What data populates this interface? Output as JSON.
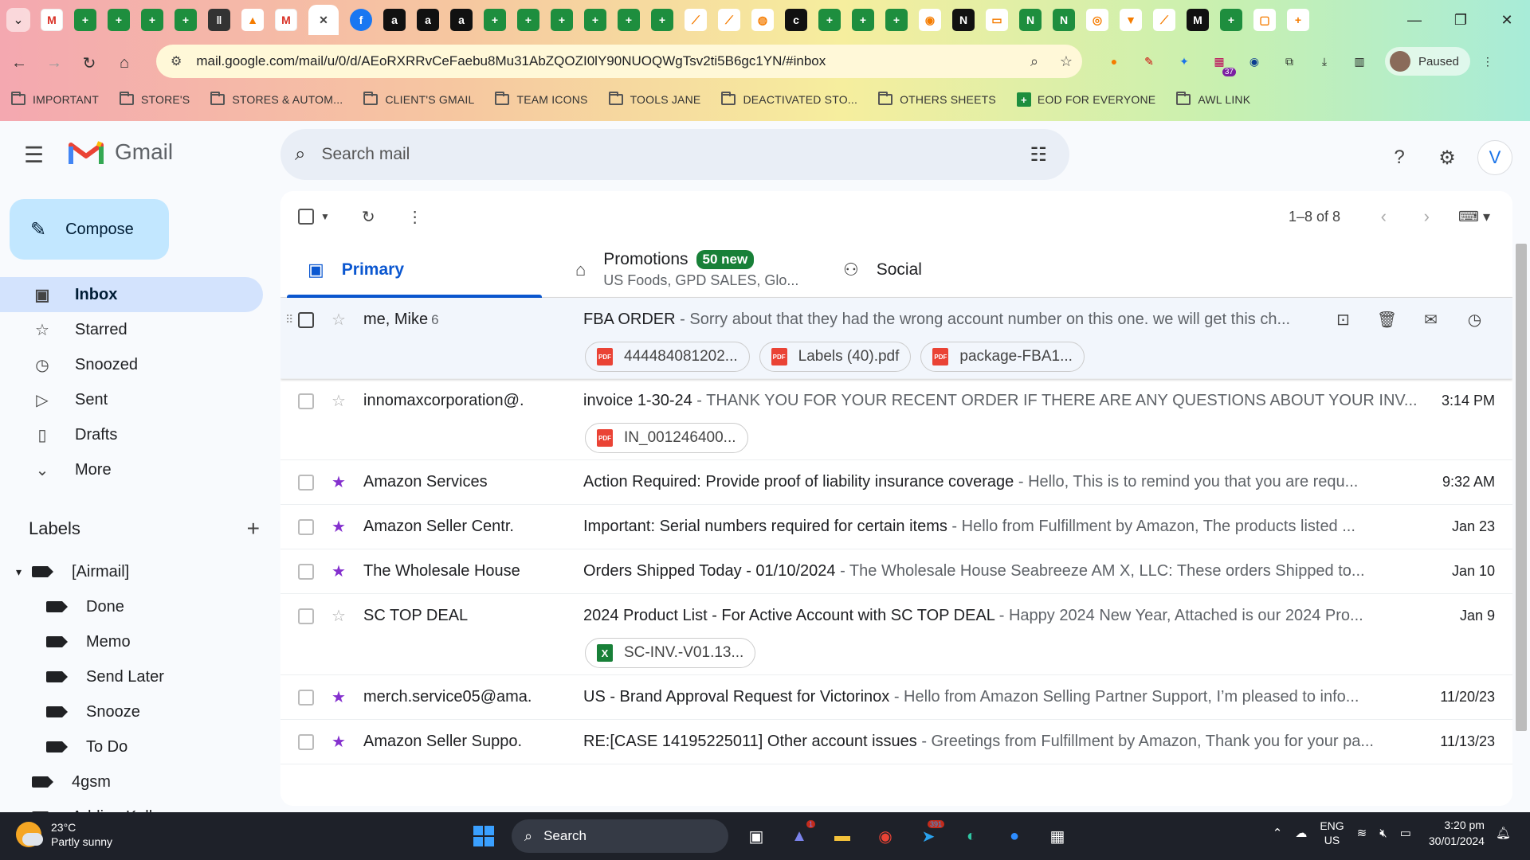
{
  "browser": {
    "url": "mail.google.com/mail/u/0/d/AEoRXRRvCeFaebu8Mu31AbZQOZI0lY90NUOQWgTsv2ti5B6gc1YN/#inbox",
    "profile_status": "Paused",
    "ext_badge": "37",
    "bookmarks": [
      {
        "label": "IMPORTANT",
        "icon": "folder-icon"
      },
      {
        "label": "STORE'S",
        "icon": "folder-icon"
      },
      {
        "label": "STORES & AUTOM...",
        "icon": "folder-icon"
      },
      {
        "label": "CLIENT'S GMAIL",
        "icon": "folder-icon"
      },
      {
        "label": "TEAM ICONS",
        "icon": "folder-icon"
      },
      {
        "label": "TOOLS JANE",
        "icon": "folder-icon"
      },
      {
        "label": "DEACTIVATED STO...",
        "icon": "folder-icon"
      },
      {
        "label": "OTHERS SHEETS",
        "icon": "folder-icon"
      },
      {
        "label": "EOD FOR EVERYONE",
        "icon": "sheets-icon"
      },
      {
        "label": "AWL LINK",
        "icon": "folder-icon"
      }
    ]
  },
  "gmail": {
    "brand": "Gmail",
    "search_placeholder": "Search mail",
    "avatar_initial": "V",
    "compose_label": "Compose",
    "nav": [
      {
        "label": "Inbox",
        "icon": "inbox-icon"
      },
      {
        "label": "Starred",
        "icon": "star-icon"
      },
      {
        "label": "Snoozed",
        "icon": "clock-icon"
      },
      {
        "label": "Sent",
        "icon": "send-icon"
      },
      {
        "label": "Drafts",
        "icon": "draft-icon"
      },
      {
        "label": "More",
        "icon": "chevron-down-icon"
      }
    ],
    "labels_title": "Labels",
    "labels": [
      {
        "label": "[Airmail]"
      },
      {
        "label": "Done"
      },
      {
        "label": "Memo"
      },
      {
        "label": "Send Later"
      },
      {
        "label": "Snooze"
      },
      {
        "label": "To Do"
      },
      {
        "label": "4gsm"
      },
      {
        "label": "Adding Kell..."
      }
    ],
    "pager": "1–8 of 8",
    "tabs": {
      "primary": "Primary",
      "promotions": "Promotions",
      "promotions_badge": "50 new",
      "promotions_sub": "US Foods, GPD SALES, Glo...",
      "social": "Social"
    },
    "emails": [
      {
        "from": "me, Mike",
        "count": "6",
        "subject": "FBA ORDER",
        "snippet": " - Sorry about that they had the wrong account number on this one. we will get this ch...",
        "date": "",
        "starred": false,
        "attachments": [
          {
            "name": "444484081202...",
            "type": "pdf"
          },
          {
            "name": "Labels (40).pdf",
            "type": "pdf"
          },
          {
            "name": "package-FBA1...",
            "type": "pdf"
          }
        ]
      },
      {
        "from": "innomaxcorporation@.",
        "count": "",
        "subject": "invoice 1-30-24",
        "snippet": " - THANK YOU FOR YOUR RECENT ORDER IF THERE ARE ANY QUESTIONS ABOUT YOUR INV...",
        "date": "3:14 PM",
        "starred": false,
        "attachments": [
          {
            "name": "IN_001246400...",
            "type": "pdf"
          }
        ]
      },
      {
        "from": "Amazon Services",
        "count": "",
        "subject": "Action Required: Provide proof of liability insurance coverage",
        "snippet": " - Hello, This is to remind you that you are requ...",
        "date": "9:32 AM",
        "starred": true,
        "attachments": []
      },
      {
        "from": "Amazon Seller Centr.",
        "count": "",
        "subject": "Important: Serial numbers required for certain items",
        "snippet": " - Hello from Fulfillment by Amazon, The products listed ...",
        "date": "Jan 23",
        "starred": true,
        "attachments": []
      },
      {
        "from": "The Wholesale House",
        "count": "",
        "subject": "Orders Shipped Today - 01/10/2024",
        "snippet": " - The Wholesale House Seabreeze AM X, LLC: These orders Shipped to...",
        "date": "Jan 10",
        "starred": true,
        "attachments": []
      },
      {
        "from": "SC TOP DEAL",
        "count": "",
        "subject": "2024 Product List - For Active Account with SC TOP DEAL",
        "snippet": " - Happy 2024 New Year, Attached is our 2024 Pro...",
        "date": "Jan 9",
        "starred": false,
        "attachments": [
          {
            "name": "SC-INV.-V01.13...",
            "type": "xls"
          }
        ]
      },
      {
        "from": "merch.service05@ama.",
        "count": "",
        "subject": "US - Brand Approval Request for Victorinox",
        "snippet": " - Hello from Amazon Selling Partner Support, I’m pleased to info...",
        "date": "11/20/23",
        "starred": true,
        "attachments": []
      },
      {
        "from": "Amazon Seller Suppo.",
        "count": "",
        "subject": "RE:[CASE 14195225011] Other account issues",
        "snippet": " - Greetings from Fulfillment by Amazon, Thank you for your pa...",
        "date": "11/13/23",
        "starred": true,
        "attachments": []
      }
    ]
  },
  "taskbar": {
    "temp": "23°C",
    "weather": "Partly sunny",
    "search": "Search",
    "teams_badge": "1",
    "telegram_badge": "391",
    "lang1": "ENG",
    "lang2": "US",
    "time": "3:20 pm",
    "date": "30/01/2024"
  }
}
